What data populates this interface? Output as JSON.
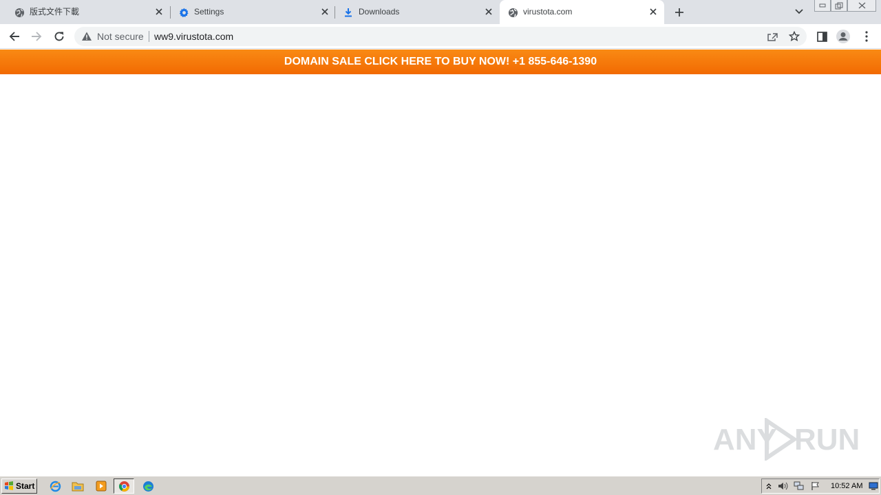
{
  "tabs": [
    {
      "title": "版式文件下載",
      "favicon": "globe-icon"
    },
    {
      "title": "Settings",
      "favicon": "gear-icon"
    },
    {
      "title": "Downloads",
      "favicon": "download-icon"
    },
    {
      "title": "virustota.com",
      "favicon": "globe-icon",
      "active": true
    }
  ],
  "omnibox": {
    "security_label": "Not secure",
    "url": "ww9.virustota.com"
  },
  "banner": {
    "text": "DOMAIN SALE CLICK HERE TO BUY NOW! +1 855-646-1390",
    "color_start": "#f98a14",
    "color_end": "#f26a02"
  },
  "watermark": {
    "left": "ANY",
    "right": "RUN"
  },
  "taskbar": {
    "start_label": "Start",
    "clock": "10:52 AM",
    "quick_launch": [
      "internet-explorer-icon",
      "file-explorer-icon",
      "media-player-icon",
      "chrome-icon",
      "edge-icon"
    ]
  },
  "colors": {
    "tabstrip_bg": "#dee1e6",
    "accent_blue": "#1a73e8",
    "taskbar_bg": "#d6d3ce"
  }
}
